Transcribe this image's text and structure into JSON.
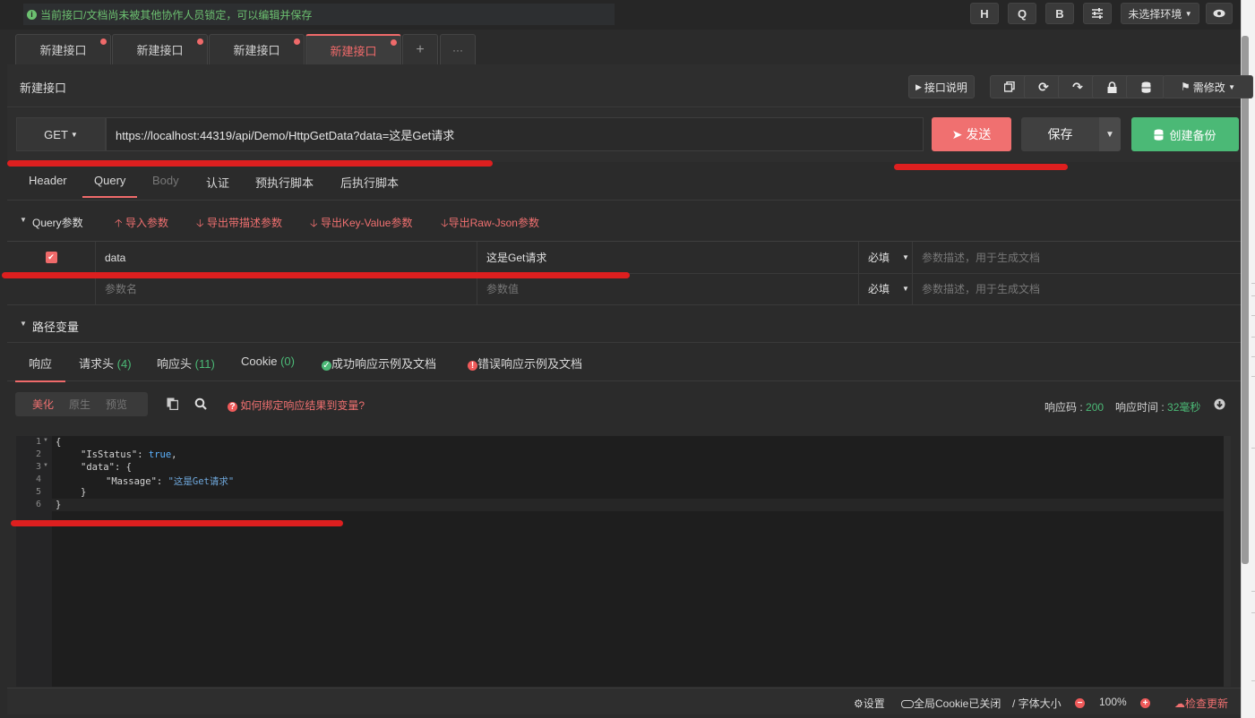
{
  "topbar": {
    "lock_message": "当前接口/文档尚未被其他协作人员锁定，可以编辑并保存",
    "btn_h": "H",
    "btn_q": "Q",
    "btn_b": "B",
    "env_select": "未选择环境",
    "icons": [
      "sliders-icon",
      "eye-icon"
    ]
  },
  "tabs": [
    {
      "label": "新建接口"
    },
    {
      "label": "新建接口"
    },
    {
      "label": "新建接口"
    },
    {
      "label": "新建接口"
    }
  ],
  "tab_add": "+",
  "tab_more": "···",
  "title_row": {
    "title": "新建接口",
    "doc_button": "接口说明",
    "modify_select": "需修改"
  },
  "request": {
    "method": "GET",
    "url": "https://localhost:44319/api/Demo/HttpGetData?data=这是Get请求",
    "send_label": "发送",
    "save_label": "保存",
    "backup_label": "创建备份"
  },
  "req_tabs": [
    "Header",
    "Query",
    "Body",
    "认证",
    "预执行脚本",
    "后执行脚本"
  ],
  "query": {
    "section_label": "Query参数",
    "import_label": "导入参数",
    "export_desc_label": "导出带描述参数",
    "export_kv_label": "导出Key-Value参数",
    "export_raw_label": "导出Raw-Json参数",
    "rows": [
      {
        "name": "data",
        "value": "这是Get请求",
        "required": "必填",
        "desc_placeholder": "参数描述，用于生成文档"
      }
    ],
    "new_row": {
      "name_placeholder": "参数名",
      "value_placeholder": "参数值",
      "required": "必填",
      "desc_placeholder": "参数描述，用于生成文档"
    }
  },
  "path_vars_label": "路径变量",
  "resp_tabs": {
    "response": "响应",
    "req_headers": "请求头",
    "req_headers_count": "(4)",
    "resp_headers": "响应头",
    "resp_headers_count": "(11)",
    "cookie": "Cookie",
    "cookie_count": "(0)",
    "success_example": "成功响应示例及文档",
    "error_example": "错误响应示例及文档"
  },
  "resp_toolbar": {
    "beautify": "美化",
    "raw": "原生",
    "preview": "预览",
    "bind_hint": "如何绑定响应结果到变量?",
    "code_label": "响应码 : ",
    "code_value": "200",
    "time_label": "响应时间 : ",
    "time_value": "32毫秒"
  },
  "code_lines": [
    {
      "n": "1",
      "text": "{"
    },
    {
      "n": "2",
      "key": "\"IsStatus\"",
      "sep": ": ",
      "val": "true",
      "tail": ","
    },
    {
      "n": "3",
      "key": "\"data\"",
      "sep": ": ",
      "tail2": "{"
    },
    {
      "n": "4",
      "key": "\"Massage\"",
      "sep": ": ",
      "str": "\"这是Get请求\""
    },
    {
      "n": "5",
      "text": "}"
    },
    {
      "n": "6",
      "text": "}"
    }
  ],
  "statusbar": {
    "settings": "设置",
    "cookie_off": "全局Cookie已关闭",
    "font_size": "/ 字体大小",
    "zoom": "100%",
    "check_update": "检查更新"
  },
  "colors": {
    "accent": "#ef6a6a",
    "success": "#4bb976",
    "background": "#2b2b2b",
    "annotation": "#dd1f1f"
  }
}
